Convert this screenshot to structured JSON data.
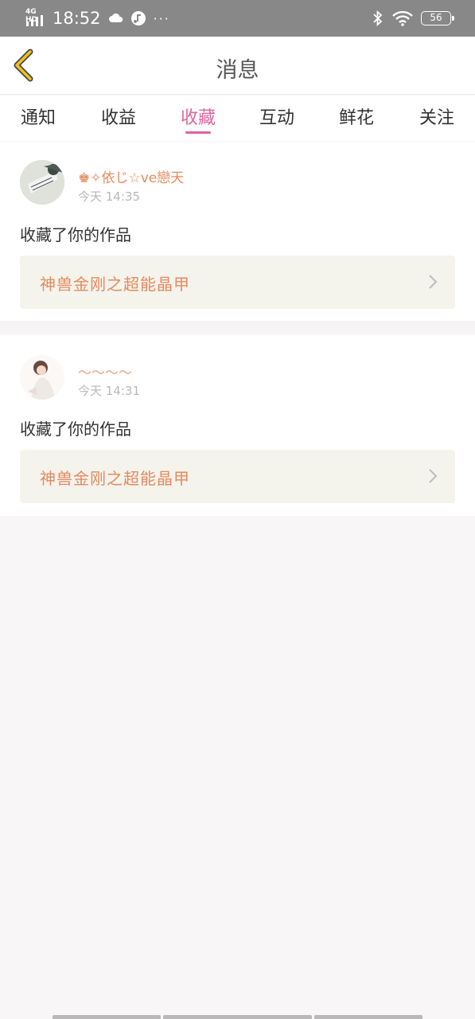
{
  "status_bar": {
    "network": "4G HD",
    "time": "18:52",
    "overflow": "···",
    "battery": "56",
    "icons": [
      "signal-icon",
      "cloud-icon",
      "music-note-icon",
      "bluetooth-icon",
      "wifi-icon",
      "battery-icon"
    ]
  },
  "header": {
    "title": "消息",
    "back_icon": "chevron-left-icon",
    "back_color": "#f0c020"
  },
  "tabs": [
    {
      "label": "通知",
      "active": false
    },
    {
      "label": "收益",
      "active": false
    },
    {
      "label": "收藏",
      "active": true
    },
    {
      "label": "互动",
      "active": false
    },
    {
      "label": "鲜花",
      "active": false
    },
    {
      "label": "关注",
      "active": false
    }
  ],
  "accent_color": "#e064a0",
  "messages": [
    {
      "username": "♚✧依じ☆ve戀天",
      "time": "今天 14:35",
      "action": "收藏了你的作品",
      "work_title": "神兽金刚之超能晶甲"
    },
    {
      "username": "～～～～",
      "time": "今天 14:31",
      "action": "收藏了你的作品",
      "work_title": "神兽金刚之超能晶甲"
    }
  ]
}
